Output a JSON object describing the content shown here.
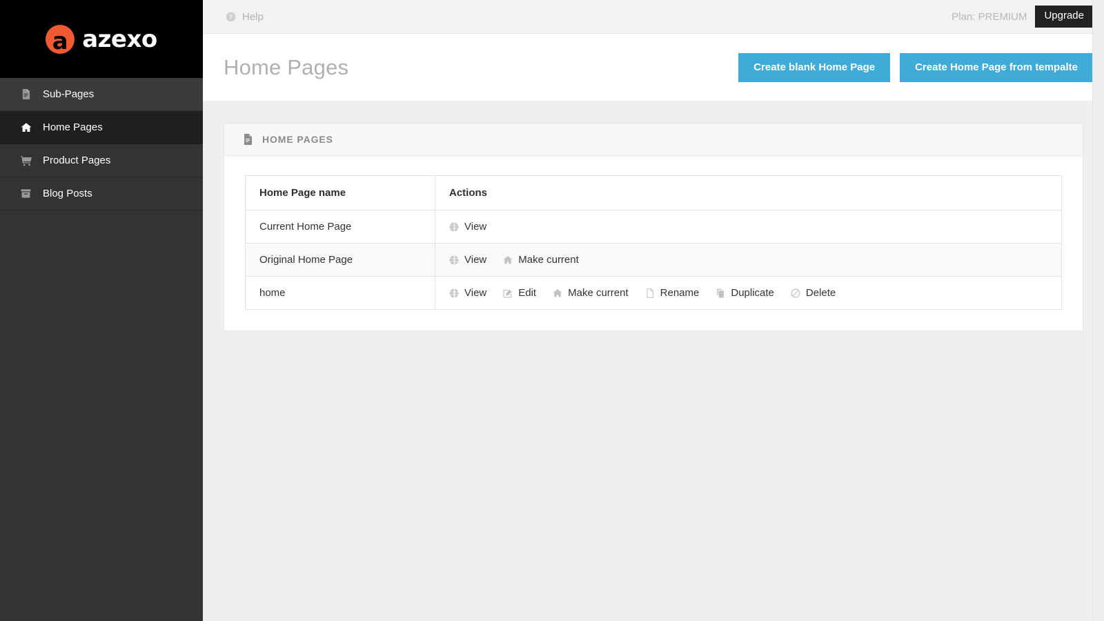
{
  "brand": {
    "mark_letter": "a",
    "name": "azexo"
  },
  "sidebar": {
    "items": [
      {
        "label": "Sub-Pages",
        "icon": "file-icon",
        "state": "hovered"
      },
      {
        "label": "Home Pages",
        "icon": "home-icon",
        "state": "active"
      },
      {
        "label": "Product Pages",
        "icon": "cart-icon",
        "state": "normal"
      },
      {
        "label": "Blog Posts",
        "icon": "archive-icon",
        "state": "normal"
      }
    ]
  },
  "topbar": {
    "help_label": "Help",
    "help_icon": "question-circle-icon",
    "plan_label": "Plan: PREMIUM",
    "upgrade_label": "Upgrade"
  },
  "page": {
    "title": "Home Pages",
    "primary_actions": [
      {
        "label": "Create blank Home Page"
      },
      {
        "label": "Create Home Page from tempalte"
      }
    ]
  },
  "panel": {
    "icon": "file-icon",
    "title": "HOME PAGES"
  },
  "table": {
    "columns": [
      "Home Page name",
      "Actions"
    ],
    "rows": [
      {
        "name": "Current Home Page",
        "actions": [
          {
            "label": "View",
            "icon": "globe-icon"
          }
        ]
      },
      {
        "name": "Original Home Page",
        "actions": [
          {
            "label": "View",
            "icon": "globe-icon"
          },
          {
            "label": "Make current",
            "icon": "home-icon"
          }
        ]
      },
      {
        "name": "home",
        "actions": [
          {
            "label": "View",
            "icon": "globe-icon"
          },
          {
            "label": "Edit",
            "icon": "pencil-square-icon"
          },
          {
            "label": "Make current",
            "icon": "home-icon"
          },
          {
            "label": "Rename",
            "icon": "file-icon"
          },
          {
            "label": "Duplicate",
            "icon": "copy-icon"
          },
          {
            "label": "Delete",
            "icon": "ban-icon"
          }
        ]
      }
    ]
  },
  "colors": {
    "brand_orange": "#f05a33",
    "sidebar_bg": "#333333",
    "sidebar_active_bg": "#1f1f1f",
    "primary_blue": "#3fabd8",
    "upgrade_dark": "#222222",
    "page_bg": "#efefef"
  }
}
